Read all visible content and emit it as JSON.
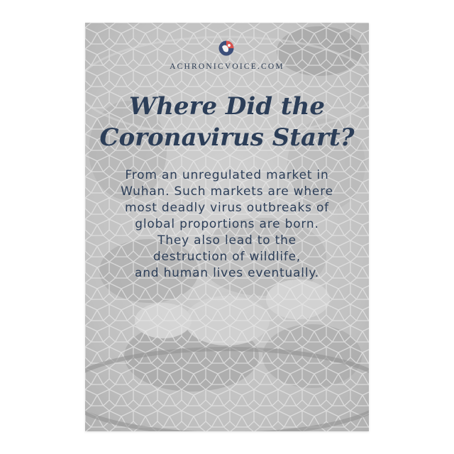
{
  "site": "ACHRONICVOICE.COM",
  "title_lines": [
    "Where Did the",
    "Coronavirus Start?"
  ],
  "body_lines": [
    "From an unregulated market in",
    "Wuhan. Such markets are where",
    "most deadly virus outbreaks of",
    "global proportions are born.",
    "They also lead to the",
    "destruction of wildlife,",
    "and human lives eventually."
  ],
  "colors": {
    "text": "#2c3e58",
    "card_background": "#b9b9b9",
    "logo_blue": "#3d4f7a",
    "logo_red": "#d9534f"
  },
  "icons": {
    "logo": "achronicvoice-logo",
    "photo": "caged-chickens-photo"
  }
}
